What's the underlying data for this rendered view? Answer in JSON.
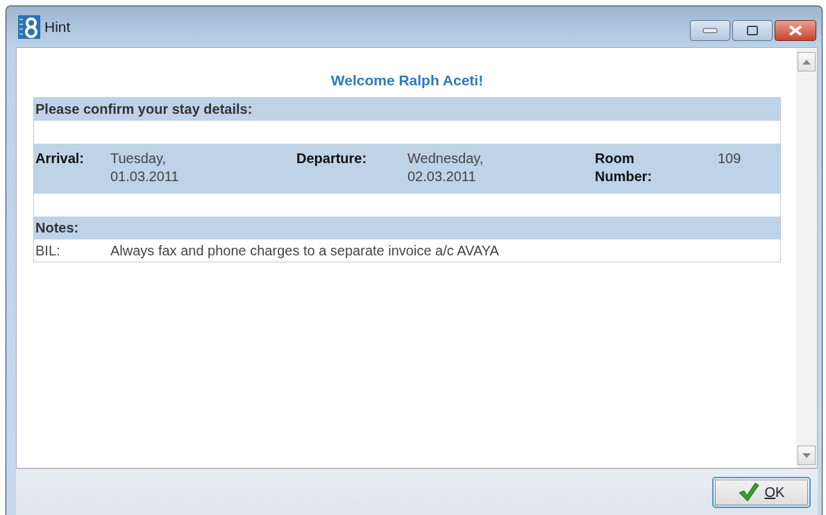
{
  "window": {
    "title": "Hint"
  },
  "welcome": "Welcome Ralph Aceti!",
  "confirm_heading": "Please confirm your stay details:",
  "stay": [
    {
      "label": "Arrival:",
      "value": "Tuesday, 01.03.2011"
    },
    {
      "label": "Departure:",
      "value": "Wednesday, 02.03.2011"
    },
    {
      "label": "Room Number:",
      "value": "109"
    }
  ],
  "notes_heading": "Notes:",
  "notes": [
    {
      "code": "BIL:",
      "text": "Always fax and phone charges to a separate invoice a/c AVAYA"
    }
  ],
  "buttons": [
    {
      "label": "OK",
      "focused": true
    }
  ]
}
